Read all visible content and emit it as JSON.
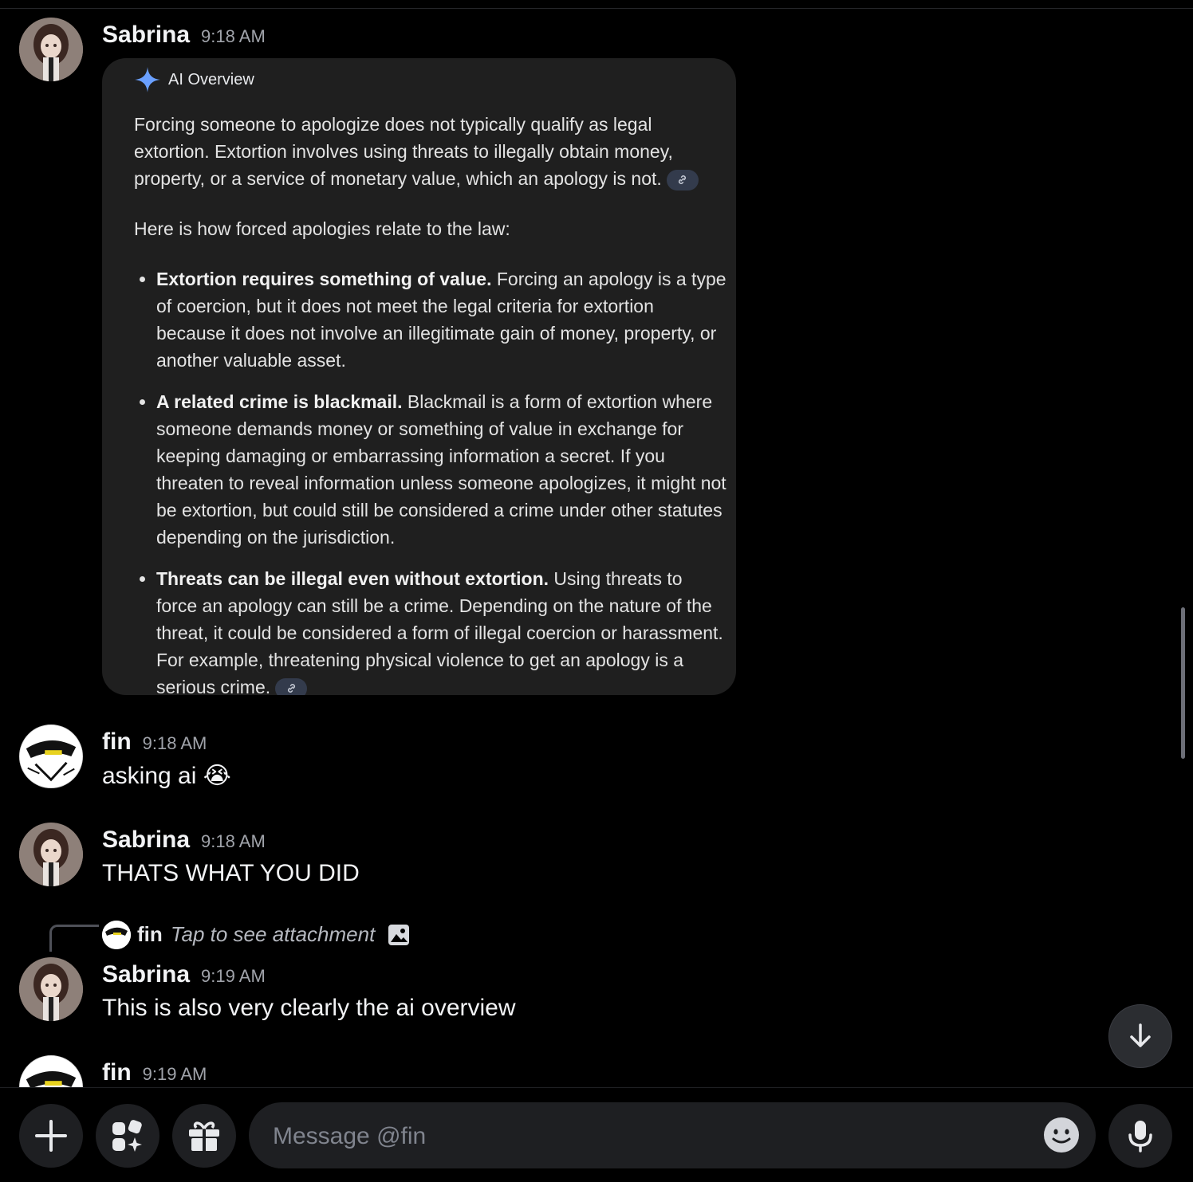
{
  "messages": [
    {
      "author": "Sabrina",
      "time": "9:18 AM"
    },
    {
      "author": "fin",
      "time": "9:18 AM",
      "text": "asking ai 😭"
    },
    {
      "author": "Sabrina",
      "time": "9:18 AM",
      "text": "THATS WHAT YOU DID"
    },
    {
      "author": "Sabrina",
      "time": "9:19 AM",
      "text": "This is also very clearly the ai overview"
    },
    {
      "author": "fin",
      "time": "9:19 AM"
    }
  ],
  "ai_overview": {
    "label": "AI Overview",
    "intro": "Forcing someone to apologize does not typically qualify as legal extortion. Extortion involves using threats to illegally obtain money, property, or a service of monetary value, which an apology is not.",
    "lead": "Here is how forced apologies relate to the law:",
    "bullets": [
      {
        "bold": "Extortion requires something of value.",
        "text": " Forcing an apology is a type of coercion, but it does not meet the legal criteria for extortion because it does not involve an illegitimate gain of money, property, or another valuable asset."
      },
      {
        "bold": "A related crime is blackmail.",
        "text": " Blackmail is a form of extortion where someone demands money or something of value in exchange for keeping damaging or embarrassing information a secret. If you threaten to reveal information unless someone apologizes, it might not be extortion, but could still be considered a crime under other statutes depending on the jurisdiction."
      },
      {
        "bold": "Threats can be illegal even without extortion.",
        "text": " Using threats to force an apology can still be a crime. Depending on the nature of the threat, it could be considered a form of illegal coercion or harassment. For example, threatening physical violence to get an apology is a serious crime."
      }
    ]
  },
  "reply": {
    "author": "fin",
    "text": "Tap to see attachment",
    "icon": "image-icon"
  },
  "composer": {
    "placeholder": "Message @fin"
  },
  "icons": {
    "add": "plus-icon",
    "apps": "apps-icon",
    "gift": "gift-icon",
    "emoji": "emoji-icon",
    "mic": "microphone-icon",
    "jump": "arrow-down-icon",
    "sparkle": "sparkle-icon",
    "link": "link-icon"
  },
  "colors": {
    "background": "#000000",
    "card": "#1f1f1f",
    "sparkle": "#6aa0ff",
    "muted": "#a0a3aa"
  }
}
